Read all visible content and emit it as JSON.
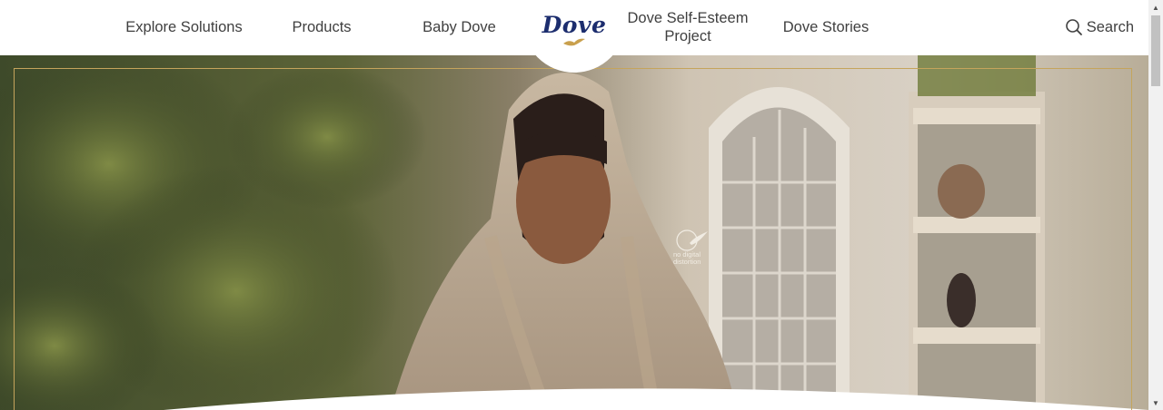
{
  "nav": {
    "items": [
      {
        "label": "Explore Solutions"
      },
      {
        "label": "Products"
      },
      {
        "label": "Baby Dove"
      },
      {
        "label": "Dove Self-Esteem Project"
      },
      {
        "label": "Dove Stories"
      }
    ],
    "logo": "Dove",
    "search_label": "Search",
    "search_icon": "search-icon"
  },
  "hero": {
    "badge_text": "no digital distortion",
    "badge_icon": "dove-bird-icon"
  },
  "colors": {
    "brand_navy": "#1c2d6e",
    "gold_accent": "#c5a45c",
    "nav_text": "#3f3f3f"
  }
}
